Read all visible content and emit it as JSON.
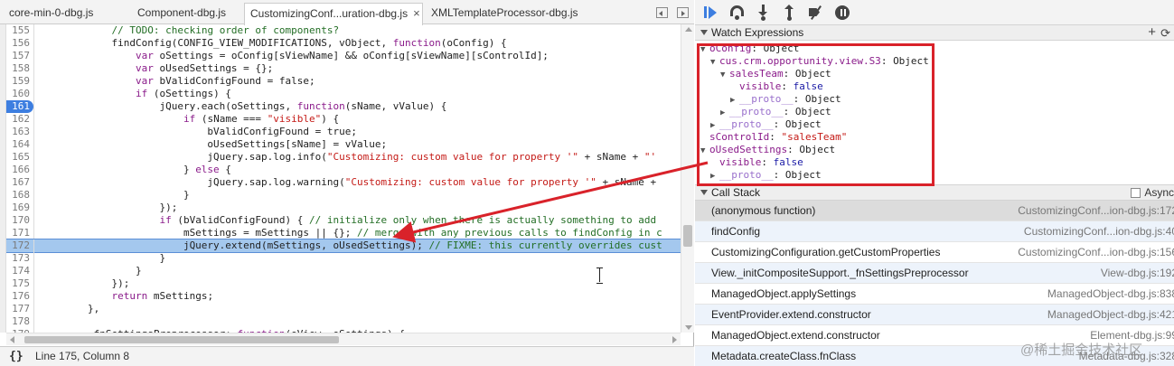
{
  "tabs": [
    {
      "label": "core-min-0-dbg.js",
      "closable": false
    },
    {
      "label": "Component-dbg.js",
      "closable": false
    },
    {
      "label": "CustomizingConf...uration-dbg.js",
      "closable": true
    },
    {
      "label": "XMLTemplateProcessor-dbg.js",
      "closable": false
    }
  ],
  "code": {
    "lines": [
      {
        "n": "155",
        "t": "            // TODO: checking order of components?"
      },
      {
        "n": "156",
        "t": "            findConfig(CONFIG_VIEW_MODIFICATIONS, vObject, function(oConfig) {"
      },
      {
        "n": "157",
        "t": "                var oSettings = oConfig[sViewName] && oConfig[sViewName][sControlId];"
      },
      {
        "n": "158",
        "t": "                var oUsedSettings = {};"
      },
      {
        "n": "159",
        "t": "                var bValidConfigFound = false;"
      },
      {
        "n": "160",
        "t": "                if (oSettings) {"
      },
      {
        "n": "161",
        "t": "                    jQuery.each(oSettings, function(sName, vValue) {"
      },
      {
        "n": "162",
        "t": "                        if (sName === \"visible\") {"
      },
      {
        "n": "163",
        "t": "                            bValidConfigFound = true;"
      },
      {
        "n": "164",
        "t": "                            oUsedSettings[sName] = vValue;"
      },
      {
        "n": "165",
        "t": "                            jQuery.sap.log.info(\"Customizing: custom value for property '\" + sName + \"'"
      },
      {
        "n": "166",
        "t": "                        } else {"
      },
      {
        "n": "167",
        "t": "                            jQuery.sap.log.warning(\"Customizing: custom value for property '\" + sName +"
      },
      {
        "n": "168",
        "t": "                        }"
      },
      {
        "n": "169",
        "t": "                    });"
      },
      {
        "n": "170",
        "t": "                    if (bValidConfigFound) { // initialize only when there is actually something to add"
      },
      {
        "n": "171",
        "t": "                        mSettings = mSettings || {}; // merge with any previous calls to findConfig in c"
      },
      {
        "n": "172",
        "t": "                        jQuery.extend(mSettings, oUsedSettings); // FIXME: this currently overrides cust"
      },
      {
        "n": "173",
        "t": "                    }"
      },
      {
        "n": "174",
        "t": "                }"
      },
      {
        "n": "175",
        "t": "            });"
      },
      {
        "n": "176",
        "t": "            return mSettings;"
      },
      {
        "n": "177",
        "t": "        },"
      },
      {
        "n": "178",
        "t": ""
      },
      {
        "n": "179",
        "t": "        _fnSettingsPreprocessor: function(oView, oSettings) {"
      }
    ]
  },
  "status": {
    "pretty_print": "{}",
    "cursor_position": "Line 175, Column 8"
  },
  "watch": {
    "title": "Watch Expressions",
    "add": "+",
    "refresh": "⟳",
    "rows": [
      {
        "indent": 0,
        "tw": "▼",
        "key": "oConfig",
        "sep": ": ",
        "val": "Object",
        "vtype": "obj"
      },
      {
        "indent": 1,
        "tw": "▼",
        "key": "cus.crm.opportunity.view.S3",
        "sep": ": ",
        "val": "Object",
        "vtype": "obj"
      },
      {
        "indent": 2,
        "tw": "▼",
        "key": "salesTeam",
        "sep": ": ",
        "val": "Object",
        "vtype": "obj"
      },
      {
        "indent": 3,
        "tw": "",
        "key": "visible",
        "sep": ": ",
        "val": "false",
        "vtype": "bool"
      },
      {
        "indent": 3,
        "tw": "▶",
        "key": "__proto__",
        "sep": ": ",
        "val": "Object",
        "vtype": "proto"
      },
      {
        "indent": 2,
        "tw": "▶",
        "key": "__proto__",
        "sep": ": ",
        "val": "Object",
        "vtype": "proto"
      },
      {
        "indent": 1,
        "tw": "▶",
        "key": "__proto__",
        "sep": ": ",
        "val": "Object",
        "vtype": "proto"
      },
      {
        "indent": 0,
        "tw": "",
        "key": "sControlId",
        "sep": ": ",
        "val": "\"salesTeam\"",
        "vtype": "str"
      },
      {
        "indent": 0,
        "tw": "▼",
        "key": "oUsedSettings",
        "sep": ": ",
        "val": "Object",
        "vtype": "obj"
      },
      {
        "indent": 1,
        "tw": "",
        "key": "visible",
        "sep": ": ",
        "val": "false",
        "vtype": "bool"
      },
      {
        "indent": 1,
        "tw": "▶",
        "key": "__proto__",
        "sep": ": ",
        "val": "Object",
        "vtype": "proto"
      }
    ]
  },
  "call_stack": {
    "title": "Call Stack",
    "async_label": "Async",
    "frames": [
      {
        "fn": "(anonymous function)",
        "loc": "CustomizingConf...ion-dbg.js:172",
        "selected": true
      },
      {
        "fn": "findConfig",
        "loc": "CustomizingConf...ion-dbg.js:40",
        "selected": false
      },
      {
        "fn": "CustomizingConfiguration.getCustomProperties",
        "loc": "CustomizingConf...ion-dbg.js:156",
        "selected": false
      },
      {
        "fn": "View._initCompositeSupport._fnSettingsPreprocessor",
        "loc": "View-dbg.js:192",
        "selected": false
      },
      {
        "fn": "ManagedObject.applySettings",
        "loc": "ManagedObject-dbg.js:838",
        "selected": false
      },
      {
        "fn": "EventProvider.extend.constructor",
        "loc": "ManagedObject-dbg.js:421",
        "selected": false
      },
      {
        "fn": "ManagedObject.extend.constructor",
        "loc": "Element-dbg.js:99",
        "selected": false
      },
      {
        "fn": "Metadata.createClass.fnClass",
        "loc": "Metadata-dbg.js:328",
        "selected": false
      }
    ]
  },
  "watermark": "@稀土掘金技术社区",
  "colors": {
    "annotation_red": "#d9222a",
    "breakpoint_blue": "#3d7ee0",
    "exec_line": "#a4c8ee"
  }
}
